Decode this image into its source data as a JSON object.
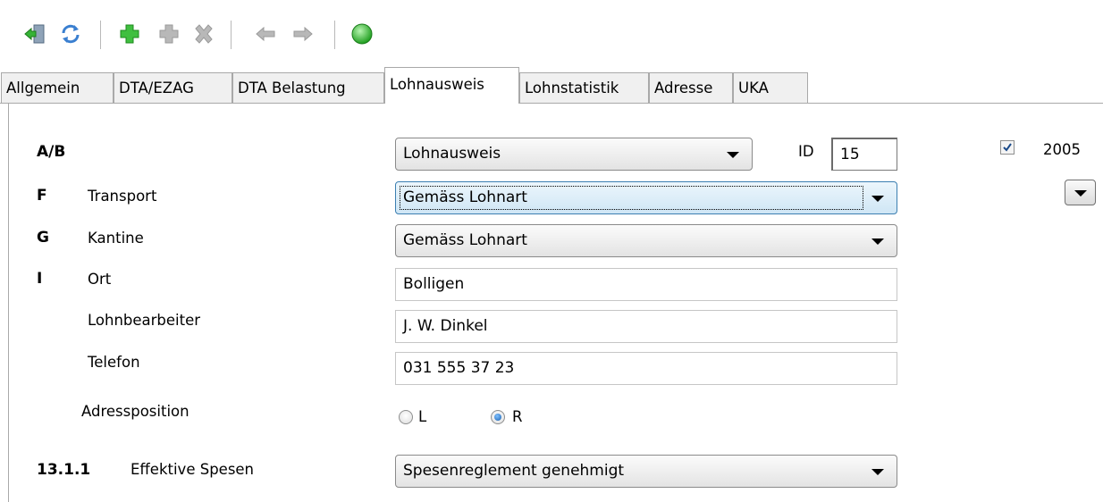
{
  "toolbar": {
    "icons": [
      "exit-icon",
      "refresh-icon",
      "add-icon",
      "add-disabled-icon",
      "delete-disabled-icon",
      "back-disabled-icon",
      "forward-disabled-icon",
      "status-green-icon"
    ]
  },
  "tabs": [
    {
      "label": "Allgemein",
      "active": false
    },
    {
      "label": "DTA/EZAG",
      "active": false
    },
    {
      "label": "DTA Belastung",
      "active": false
    },
    {
      "label": "Lohnausweis",
      "active": true
    },
    {
      "label": "Lohnstatistik",
      "active": false
    },
    {
      "label": "Adresse",
      "active": false
    },
    {
      "label": "UKA",
      "active": false
    }
  ],
  "form": {
    "row_ab": {
      "code": "A/B",
      "select_value": "Lohnausweis"
    },
    "id": {
      "label": "ID",
      "value": "15"
    },
    "year": {
      "checked": true,
      "label": "2005"
    },
    "row_f": {
      "code": "F",
      "label": "Transport",
      "select_value": "Gemäss Lohnart"
    },
    "row_g": {
      "code": "G",
      "label": "Kantine",
      "select_value": "Gemäss Lohnart"
    },
    "row_i": {
      "code": "I",
      "label": "Ort",
      "value": "Bolligen"
    },
    "lohnbearbeiter": {
      "label": "Lohnbearbeiter",
      "value": "J. W. Dinkel"
    },
    "telefon": {
      "label": "Telefon",
      "value": "031 555 37 23"
    },
    "adressposition": {
      "label": "Adressposition",
      "option_l": "L",
      "option_r": "R",
      "selected": "R"
    },
    "spesen": {
      "code": "13.1.1",
      "label": "Effektive Spesen",
      "select_value": "Spesenreglement genehmigt"
    }
  },
  "colors": {
    "tab_border": "#a9a9a9",
    "combo_focus": "#3c7fb1",
    "green_status": "#2fb52f"
  }
}
